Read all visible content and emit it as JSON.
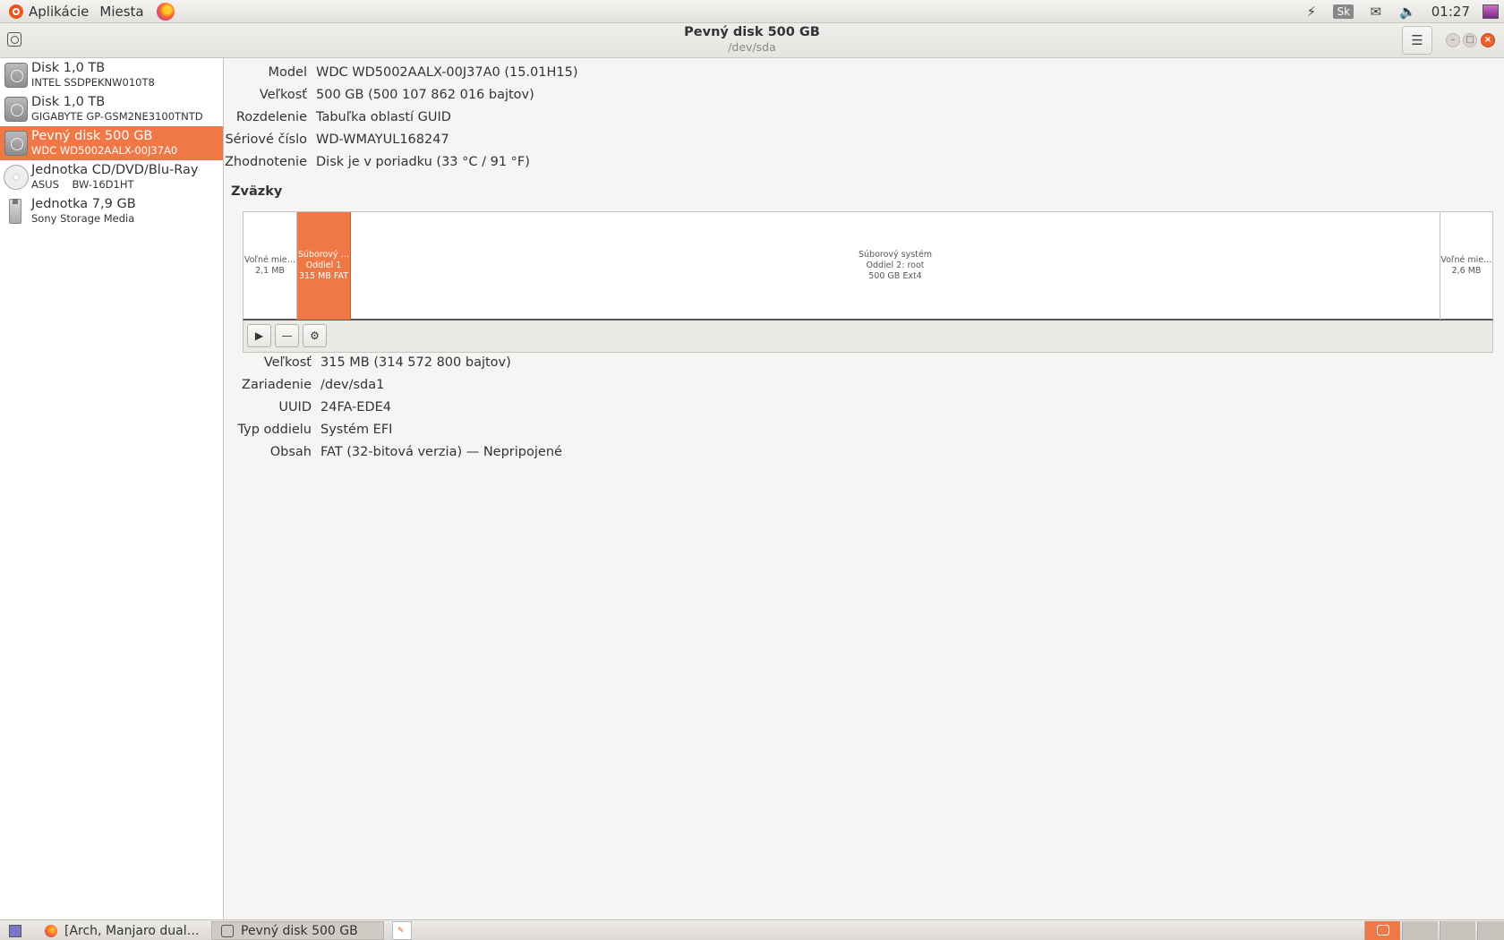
{
  "top_panel": {
    "apps_label": "Aplikácie",
    "places_label": "Miesta",
    "keyboard_layout": "Sk",
    "clock": "01:27"
  },
  "window": {
    "title": "Pevný disk 500 GB",
    "subtitle": "/dev/sda"
  },
  "devices": [
    {
      "name": "Disk 1,0 TB",
      "sub": "INTEL SSDPEKNW010T8",
      "icon": "hard-disk-icon"
    },
    {
      "name": "Disk 1,0 TB",
      "sub": "GIGABYTE GP-GSM2NE3100TNTD",
      "icon": "hard-disk-icon"
    },
    {
      "name": "Pevný disk 500 GB",
      "sub": "WDC WD5002AALX-00J37A0",
      "icon": "hard-disk-icon",
      "selected": true
    },
    {
      "name": "Jednotka CD/DVD/Blu-Ray",
      "sub": "ASUS    BW-16D1HT",
      "icon": "optical-drive-icon"
    },
    {
      "name": "Jednotka 7,9 GB",
      "sub": "Sony Storage Media",
      "icon": "usb-drive-icon"
    }
  ],
  "drive_info": [
    {
      "label": "Model",
      "value": "WDC WD5002AALX-00J37A0 (15.01H15)"
    },
    {
      "label": "Veľkosť",
      "value": "500 GB (500 107 862 016 bajtov)"
    },
    {
      "label": "Rozdelenie",
      "value": "Tabuľka oblastí GUID"
    },
    {
      "label": "Sériové číslo",
      "value": "WD-WMAYUL168247"
    },
    {
      "label": "Zhodnotenie",
      "value": "Disk je v poriadku (33 °C / 91 °F)"
    }
  ],
  "volumes_title": "Zväzky",
  "volumes": [
    {
      "line1": "Voľné mie…",
      "line2": "2,1 MB",
      "line3": ""
    },
    {
      "line1": "Súborový …",
      "line2": "Oddiel 1",
      "line3": "315 MB FAT",
      "selected": true
    },
    {
      "line1": "Súborový systém",
      "line2": "Oddiel 2: root",
      "line3": "500 GB Ext4"
    },
    {
      "line1": "Voľné mie…",
      "line2": "2,6 MB",
      "line3": ""
    }
  ],
  "partition_info": [
    {
      "label": "Veľkosť",
      "value": "315 MB (314 572 800 bajtov)"
    },
    {
      "label": "Zariadenie",
      "value": "/dev/sda1"
    },
    {
      "label": "UUID",
      "value": "24FA-EDE4"
    },
    {
      "label": "Typ oddielu",
      "value": "Systém EFI"
    },
    {
      "label": "Obsah",
      "value": "FAT (32-bitová verzia) — Nepripojené"
    }
  ],
  "taskbar": {
    "task1": "[Arch, Manjaro dual…",
    "task2": "Pevný disk 500 GB"
  },
  "colors": {
    "accent": "#f07746",
    "close": "#e9612d"
  }
}
